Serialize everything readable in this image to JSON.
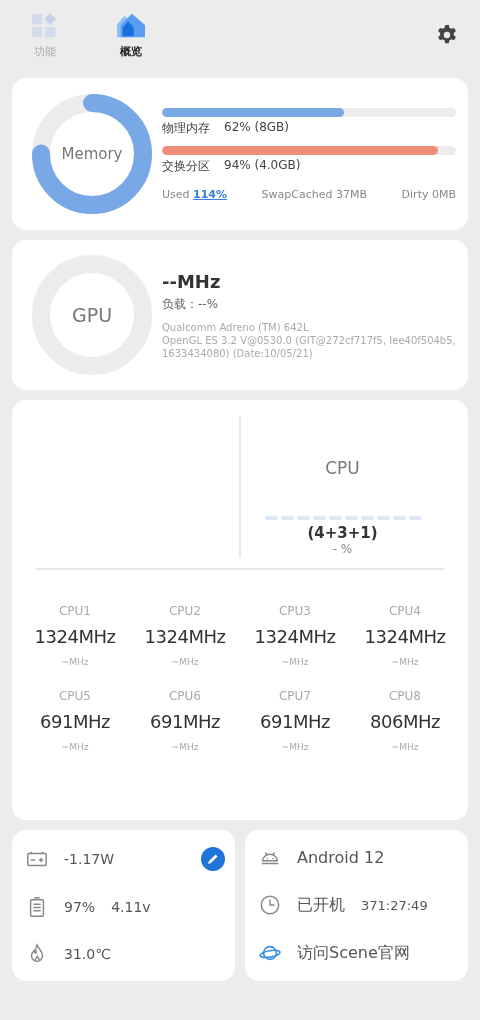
{
  "tabs": [
    {
      "label": "功能",
      "kind": "grid",
      "selected": false
    },
    {
      "label": "概览",
      "kind": "home",
      "selected": true
    }
  ],
  "memory": {
    "label": "Memory",
    "bars": [
      {
        "name": "物理内存",
        "reading": "62% (8GB)",
        "level": 0.62,
        "color": "#78a9e6"
      },
      {
        "name": "交换分区",
        "reading": "94% (4.0GB)",
        "level": 0.94,
        "color": "#ef8e78"
      }
    ],
    "stats": [
      {
        "label": "Used",
        "value": "114%",
        "kind": "highlight"
      },
      {
        "label": "SwapCached",
        "value": "37MB",
        "kind": "plain"
      },
      {
        "label": "Dirty",
        "value": "0MB",
        "kind": "plain"
      }
    ]
  },
  "gpu": {
    "label": "GPU",
    "frequency": "--MHz",
    "load": "负载：--%",
    "renderer": "Qualcomm Adreno (TM) 642L",
    "version": "OpenGL ES 3.2 V@0530.0 (GIT@272cf717f5, Iee40f504b5, 1633434080) (Date:10/05/21)"
  },
  "cpu": {
    "title": "CPU",
    "cluster": "(4+3+1)",
    "load": "- %",
    "cores": [
      {
        "name": "CPU1",
        "frequency": "1324MHz",
        "sub": "~MHz"
      },
      {
        "name": "CPU2",
        "frequency": "1324MHz",
        "sub": "~MHz"
      },
      {
        "name": "CPU3",
        "frequency": "1324MHz",
        "sub": "~MHz"
      },
      {
        "name": "CPU4",
        "frequency": "1324MHz",
        "sub": "~MHz"
      },
      {
        "name": "CPU5",
        "frequency": "691MHz",
        "sub": "~MHz"
      },
      {
        "name": "CPU6",
        "frequency": "691MHz",
        "sub": "~MHz"
      },
      {
        "name": "CPU7",
        "frequency": "691MHz",
        "sub": "~MHz"
      },
      {
        "name": "CPU8",
        "frequency": "806MHz",
        "sub": "~MHz"
      }
    ]
  },
  "power": [
    {
      "kind": "current",
      "value": "-1.17W"
    },
    {
      "kind": "battery",
      "value": "97%",
      "extra": "4.11v"
    },
    {
      "kind": "temperature",
      "value": "31.0℃"
    }
  ],
  "system": [
    {
      "kind": "android",
      "value": "Android 12"
    },
    {
      "kind": "uptime",
      "label": "已开机",
      "value": "371:27:49"
    },
    {
      "kind": "link",
      "value": "访问Scene官网"
    }
  ]
}
